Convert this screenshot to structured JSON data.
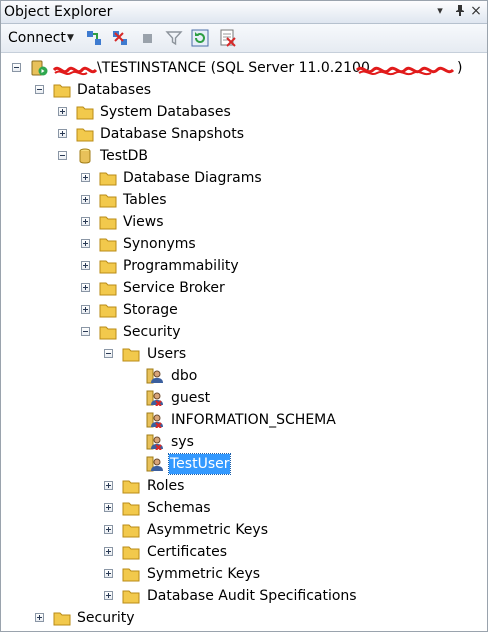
{
  "window": {
    "title": "Object Explorer",
    "pin_glyph": "▾",
    "pushpin_glyph": "ᵖ",
    "close_glyph": "×"
  },
  "toolbar": {
    "connect_label": "Connect",
    "icons": [
      "connect-icon",
      "disconnect-icon",
      "stop-icon",
      "filter-icon",
      "refresh-icon",
      "activity-monitor-icon"
    ]
  },
  "tree": {
    "server": {
      "label_mid": "\\TESTINSTANCE (SQL Server 11.0.2100 - ",
      "label_end": ")"
    },
    "databases": "Databases",
    "system_databases": "System Databases",
    "database_snapshots": "Database Snapshots",
    "testdb": "TestDB",
    "testdb_children": {
      "diagrams": "Database Diagrams",
      "tables": "Tables",
      "views": "Views",
      "synonyms": "Synonyms",
      "programmability": "Programmability",
      "service_broker": "Service Broker",
      "storage": "Storage",
      "security": "Security"
    },
    "users": "Users",
    "user_list": [
      "dbo",
      "guest",
      "INFORMATION_SCHEMA",
      "sys",
      "TestUser"
    ],
    "security_children": {
      "roles": "Roles",
      "schemas": "Schemas",
      "asymmetric_keys": "Asymmetric Keys",
      "certificates": "Certificates",
      "symmetric_keys": "Symmetric Keys",
      "audit_specs": "Database Audit Specifications"
    },
    "server_security": "Security"
  },
  "colors": {
    "selection": "#3399ff",
    "folder": "#f2c94c",
    "redaction": "#e11b1b"
  }
}
